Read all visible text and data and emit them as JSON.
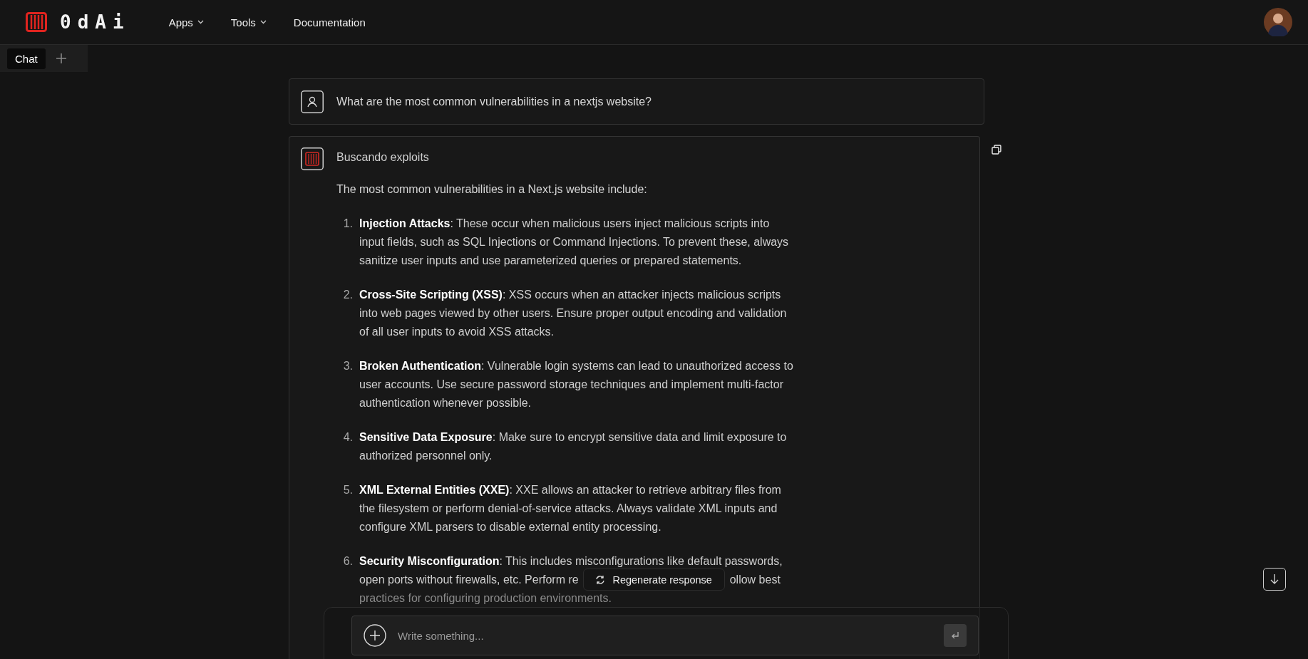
{
  "header": {
    "logo_text": "0dAi",
    "nav": [
      {
        "label": "Apps",
        "kind": "menu"
      },
      {
        "label": "Tools",
        "kind": "menu"
      },
      {
        "label": "Documentation",
        "kind": "link"
      }
    ]
  },
  "tabs": [
    {
      "label": "Chat",
      "selected": true
    }
  ],
  "conversation": [
    {
      "kind": "user",
      "text": "What are the most common vulnerabilities in a nextjs website?"
    },
    {
      "kind": "assistant",
      "status": "Buscando exploits",
      "intro": "The most common vulnerabilities in a Next.js website include:",
      "items": [
        {
          "number": "1.",
          "title": "Injection Attacks",
          "text": ": These occur when malicious users inject malicious scripts into input fields, such as SQL Injections or Command Injections. To prevent these, always sanitize user inputs and use parameterized queries or prepared statements."
        },
        {
          "number": "2.",
          "title": "Cross-Site Scripting (XSS)",
          "text": ": XSS occurs when an attacker injects malicious scripts into web pages viewed by other users. Ensure proper output encoding and validation of all user inputs to avoid XSS attacks."
        },
        {
          "number": "3.",
          "title": "Broken Authentication",
          "text": ": Vulnerable login systems can lead to unauthorized access to user accounts. Use secure password storage techniques and implement multi-factor authentication whenever possible."
        },
        {
          "number": "4.",
          "title": "Sensitive Data Exposure",
          "text": ": Make sure to encrypt sensitive data and limit exposure to authorized personnel only."
        },
        {
          "number": "5.",
          "title": "XML External Entities (XXE)",
          "text": ": XXE allows an attacker to retrieve arbitrary files from the filesystem or perform denial-of-service attacks. Always validate XML inputs and configure XML parsers to disable external entity processing."
        },
        {
          "number": "6.",
          "title": "Security Misconfiguration",
          "kind": "covered",
          "lines": [
            [
              ": This includes misconfigurations like default passwords,"
            ],
            [
              "open ports without firewalls, etc. Perform re",
              "ollow best"
            ],
            [
              "practices for configuring production environments."
            ]
          ]
        }
      ]
    }
  ],
  "regenerate_button": {
    "label": "Regenerate response"
  },
  "composer": {
    "placeholder": "Write something..."
  }
}
